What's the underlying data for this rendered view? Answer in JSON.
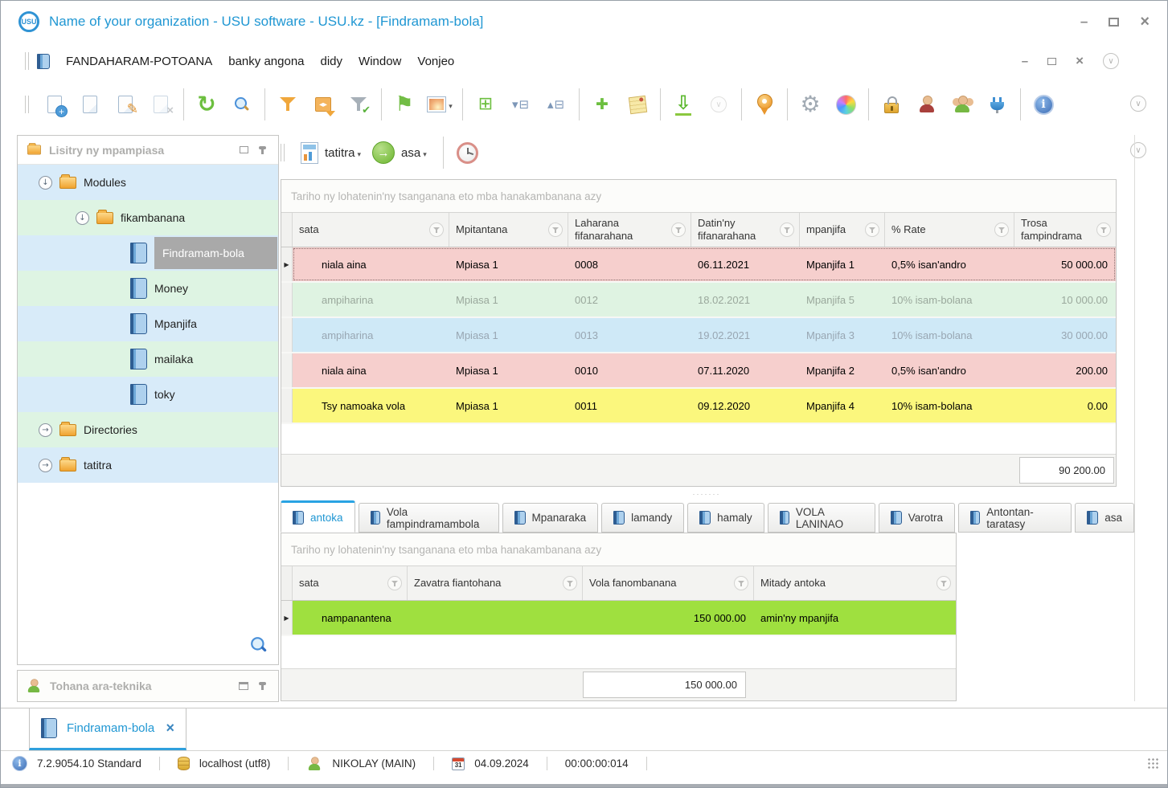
{
  "titlebar": {
    "title": "Name of your organization - USU software - USU.kz - [Findramam-bola]",
    "logo_text": "USU"
  },
  "menubar": {
    "items": [
      "FANDAHARAM-POTOANA",
      "banky angona",
      "didy",
      "Window",
      "Vonjeo"
    ]
  },
  "toolbar": {
    "icon_names": [
      "new-document",
      "copy",
      "edit",
      "delete",
      "refresh",
      "search",
      "filter",
      "filter-range",
      "filter-apply",
      "flag",
      "image",
      "expand-item",
      "collapse-tree",
      "expand-tree",
      "add-record",
      "notes",
      "export",
      "more-disabled",
      "location",
      "settings",
      "colors",
      "lock",
      "user-permissions",
      "users",
      "plugins",
      "info",
      "overflow"
    ]
  },
  "report_bar": {
    "report_label": "tatitra",
    "run_label": "asa",
    "icon_names": [
      "report",
      "run",
      "timer"
    ]
  },
  "sidebar": {
    "header": "Lisitry ny mpampiasa",
    "tree": [
      {
        "label": "Modules"
      },
      {
        "label": "fikambanana"
      },
      {
        "label": "Findramam-bola"
      },
      {
        "label": "Money"
      },
      {
        "label": "Mpanjifa"
      },
      {
        "label": "mailaka"
      },
      {
        "label": "toky"
      },
      {
        "label": "Directories"
      },
      {
        "label": "tatitra"
      }
    ],
    "support_panel": "Tohana ara-teknika"
  },
  "grid1": {
    "group_hint": "Tariho ny lohatenin'ny tsanganana eto mba hanakambanana azy",
    "columns": [
      "sata",
      "Mpitantana",
      "Laharana fifanarahana",
      "Datin'ny fifanarahana",
      "mpanjifa",
      "% Rate",
      "Trosa fampindrama"
    ],
    "rows": [
      {
        "status": "niala aina",
        "manager": "Mpiasa 1",
        "number": "0008",
        "date": "06.11.2021",
        "client": "Mpanjifa 1",
        "rate": "0,5% isan'andro",
        "debt": "50 000.00",
        "bg": "#f6cfcd",
        "fg": "#000000"
      },
      {
        "status": "ampiharina",
        "manager": "Mpiasa 1",
        "number": "0012",
        "date": "18.02.2021",
        "client": "Mpanjifa 5",
        "rate": "10% isam-bolana",
        "debt": "10 000.00",
        "bg": "#dff3e2",
        "fg": "#9aa89c"
      },
      {
        "status": "ampiharina",
        "manager": "Mpiasa 1",
        "number": "0013",
        "date": "19.02.2021",
        "client": "Mpanjifa 3",
        "rate": "10% isam-bolana",
        "debt": "30 000.00",
        "bg": "#cfe9f7",
        "fg": "#98a6b2"
      },
      {
        "status": "niala aina",
        "manager": "Mpiasa 1",
        "number": "0010",
        "date": "07.11.2020",
        "client": "Mpanjifa 2",
        "rate": "0,5% isan'andro",
        "debt": "200.00",
        "bg": "#f6cfcd",
        "fg": "#000000"
      },
      {
        "status": "Tsy namoaka vola",
        "manager": "Mpiasa 1",
        "number": "0011",
        "date": "09.12.2020",
        "client": "Mpanjifa 4",
        "rate": "10% isam-bolana",
        "debt": "0.00",
        "bg": "#fbf77d",
        "fg": "#000000"
      }
    ],
    "total": "90 200.00"
  },
  "detail_tabs": {
    "tabs": [
      {
        "label": "antoka",
        "active": true
      },
      {
        "label": "Vola fampindramambola"
      },
      {
        "label": "Mpanaraka"
      },
      {
        "label": "lamandy"
      },
      {
        "label": "hamaly"
      },
      {
        "label": "VOLA LANINAO"
      },
      {
        "label": "Varotra"
      },
      {
        "label": "Antontan-taratasy"
      },
      {
        "label": "asa"
      }
    ]
  },
  "grid2": {
    "group_hint": "Tariho ny lohatenin'ny tsanganana eto mba hanakambanana azy",
    "columns": [
      "sata",
      "Zavatra fiantohana",
      "Vola fanombanana",
      "Mitady antoka"
    ],
    "rows": [
      {
        "status": "nampanantena",
        "item": "",
        "value": "150 000.00",
        "seeker": "amin'ny mpanjifa",
        "bg": "#9fe03f",
        "fg": "#000000"
      }
    ],
    "total": "150 000.00"
  },
  "doc_tabs": {
    "tabs": [
      {
        "label": "Findramam-bola"
      }
    ]
  },
  "statusbar": {
    "version": "7.2.9054.10 Standard",
    "database": "localhost (utf8)",
    "user": "NIKOLAY (MAIN)",
    "date": "04.09.2024",
    "timer": "00:00:00:014",
    "calendar_day": "31"
  },
  "colors": {
    "accent_blue": "#2097d3",
    "selected_node_bg": "#a9a9a9",
    "tree_row_blue": "#d8ebf9",
    "tree_row_green": "#def4e3",
    "row_pink": "#f6cfcd",
    "row_green": "#dff3e2",
    "row_blue": "#cfe9f7",
    "row_yellow": "#fbf77d",
    "row_bright_green": "#9fe03f"
  }
}
